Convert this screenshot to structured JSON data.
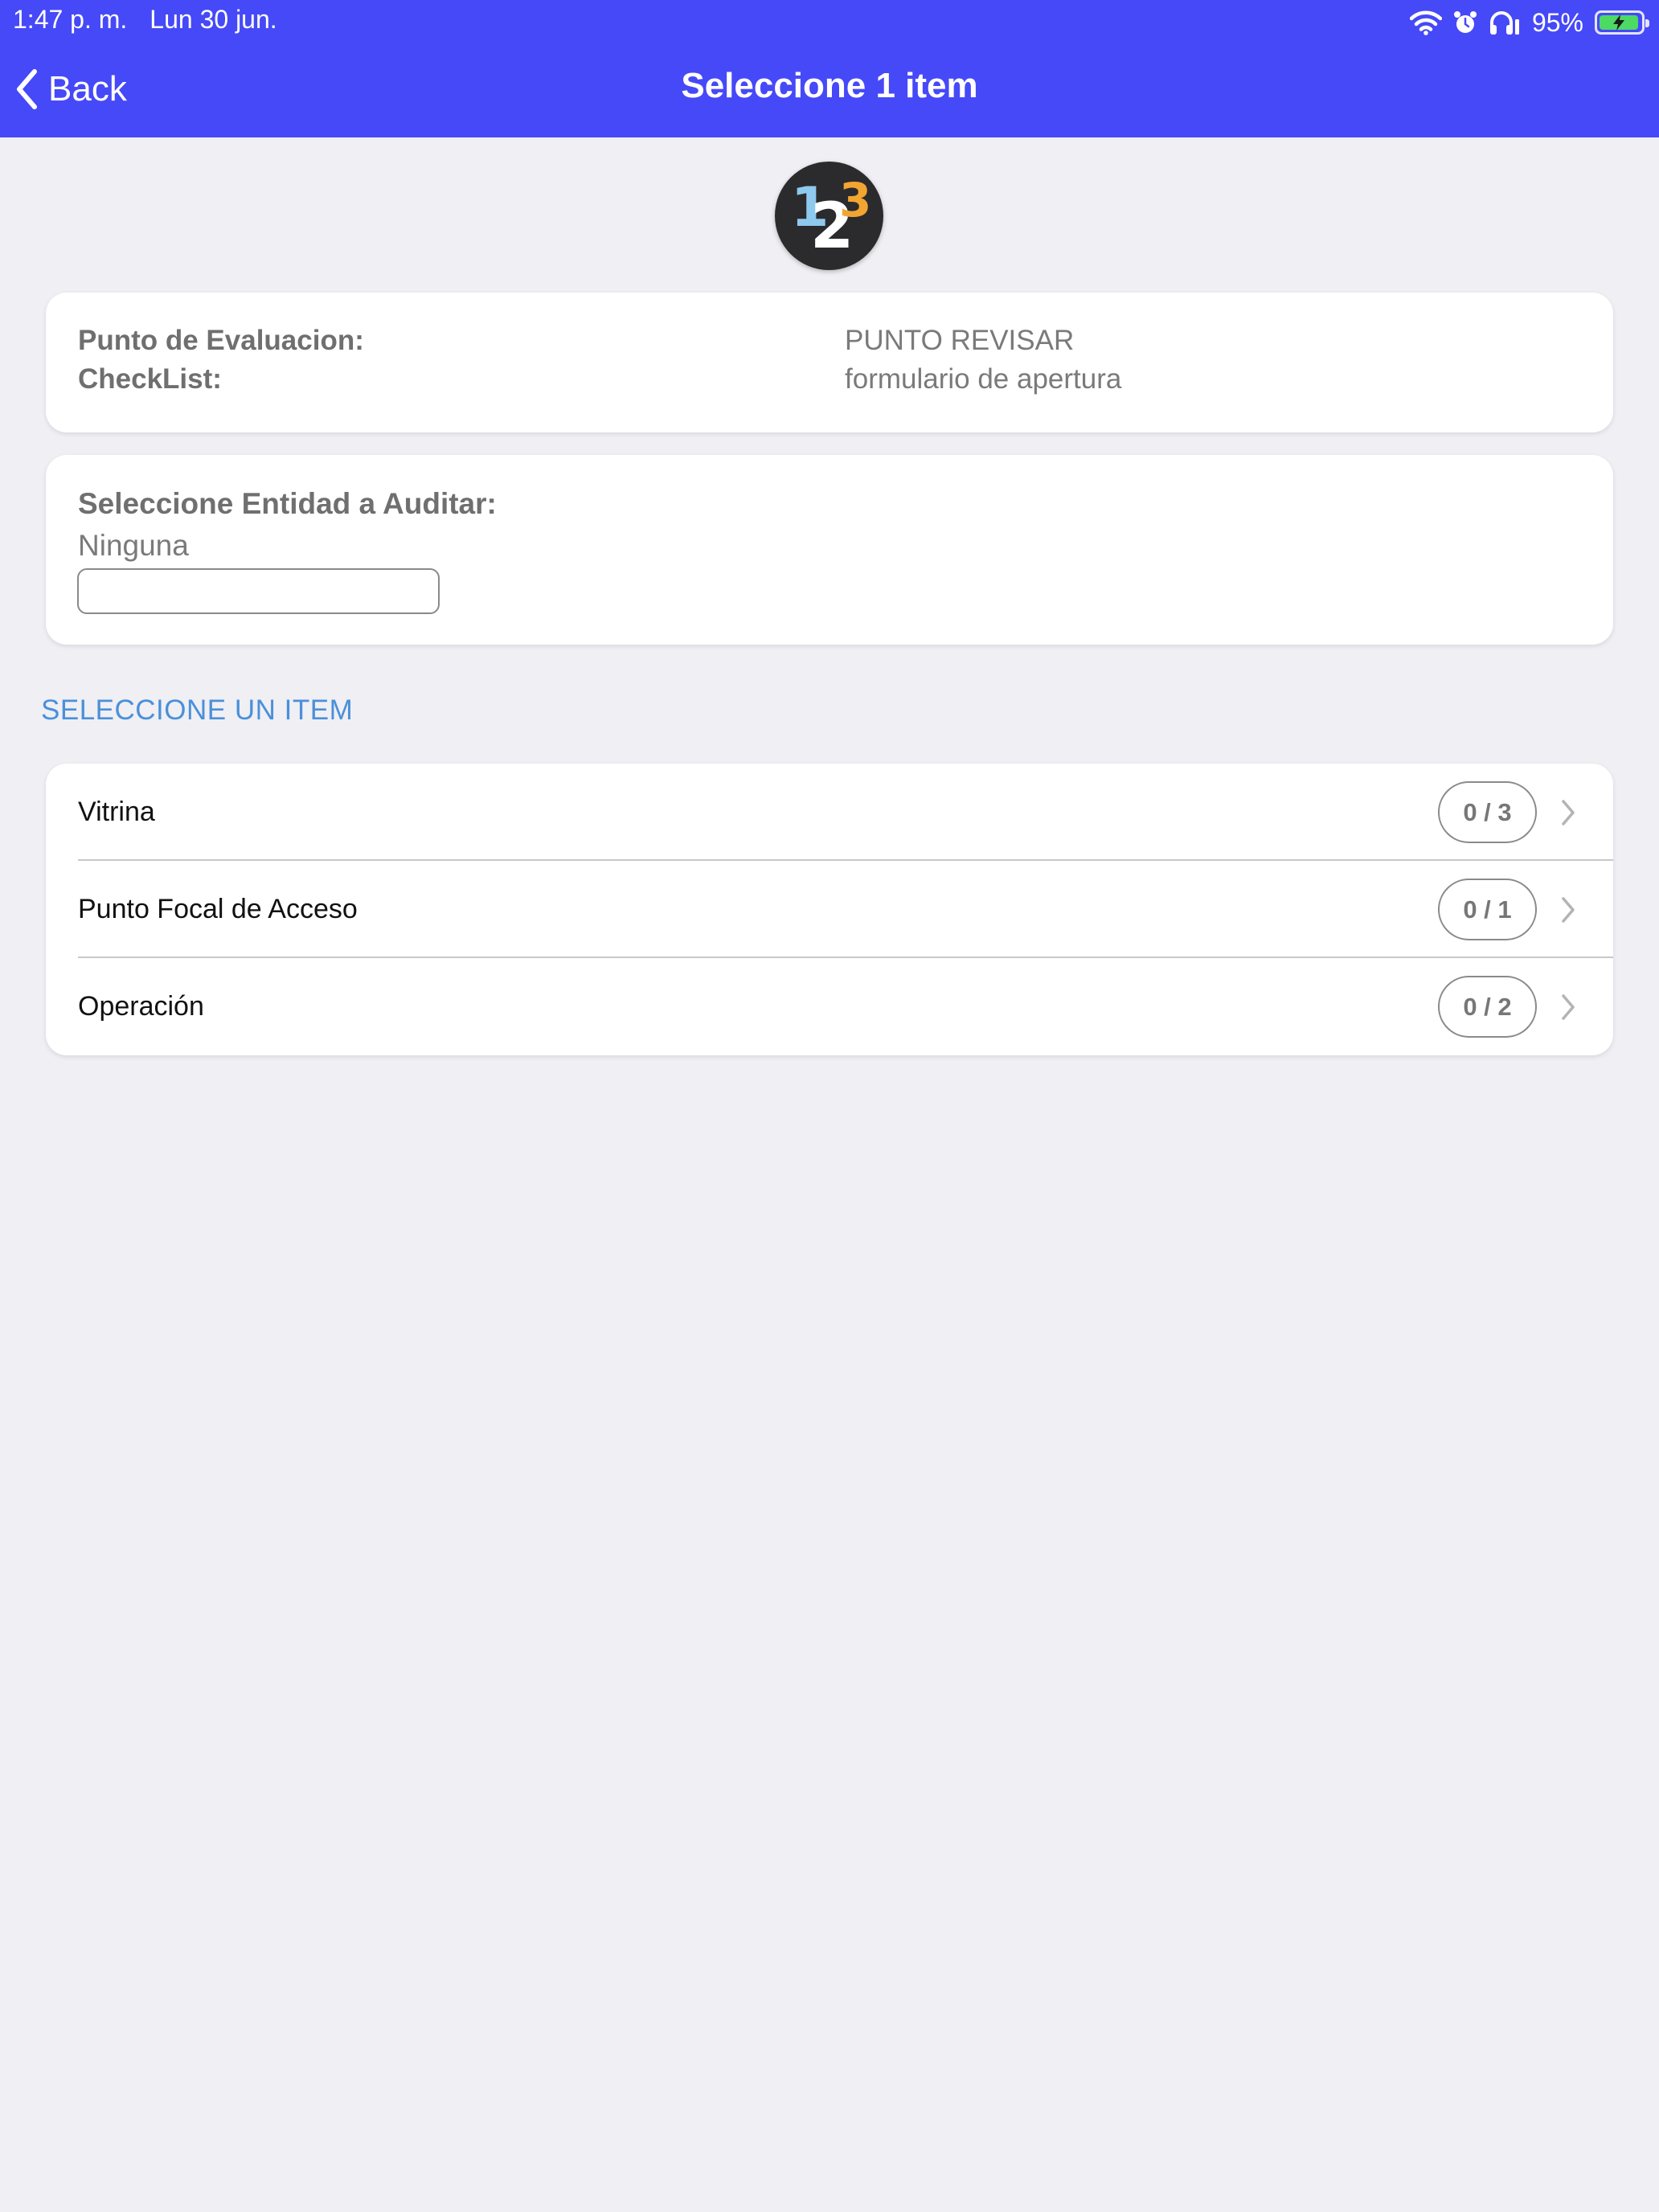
{
  "status_bar": {
    "time": "1:47 p. m.",
    "date": "Lun 30 jun.",
    "battery": "95%",
    "battery_level": 0.95,
    "icons": [
      "wifi-icon",
      "alarm-icon",
      "headphones-icon",
      "battery-icon"
    ]
  },
  "nav": {
    "back_label": "Back",
    "title": "Seleccione 1 item"
  },
  "logo": {
    "digits": [
      "1",
      "2",
      "3"
    ]
  },
  "info": {
    "punto_label": "Punto de Evaluacion:",
    "punto_value": "PUNTO REVISAR",
    "checklist_label": "CheckList:",
    "checklist_value": "formulario de apertura"
  },
  "entity": {
    "label": "Seleccione Entidad a Auditar:",
    "value": "Ninguna",
    "input_value": ""
  },
  "section": {
    "header": "SELECCIONE UN ITEM"
  },
  "items": [
    {
      "label": "Vitrina",
      "progress": "0 / 3"
    },
    {
      "label": "Punto Focal de Acceso",
      "progress": "0 / 1"
    },
    {
      "label": "Operación",
      "progress": "0 / 2"
    }
  ],
  "colors": {
    "nav_background": "#4649f7",
    "page_background": "#efeff4",
    "section_header": "#4a90d9",
    "battery_fill": "#4cd964"
  }
}
